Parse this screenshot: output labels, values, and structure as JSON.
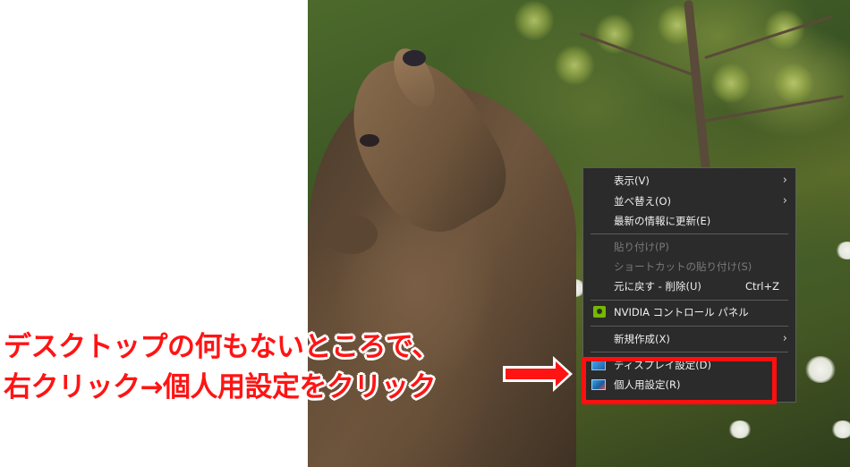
{
  "context_menu": {
    "items": [
      {
        "label": "表示(V)",
        "has_submenu": true,
        "enabled": true
      },
      {
        "label": "並べ替え(O)",
        "has_submenu": true,
        "enabled": true
      },
      {
        "label": "最新の情報に更新(E)",
        "enabled": true
      },
      {
        "label": "貼り付け(P)",
        "enabled": false
      },
      {
        "label": "ショートカットの貼り付け(S)",
        "enabled": false
      },
      {
        "label": "元に戻す - 削除(U)",
        "shortcut": "Ctrl+Z",
        "enabled": true
      },
      {
        "label": "NVIDIA コントロール パネル",
        "icon": "nvidia-icon",
        "enabled": true
      },
      {
        "label": "新規作成(X)",
        "has_submenu": true,
        "enabled": true
      },
      {
        "label": "ディスプレイ設定(D)",
        "icon": "display-settings-icon",
        "enabled": true
      },
      {
        "label": "個人用設定(R)",
        "icon": "personalize-icon",
        "enabled": true
      }
    ],
    "submenu_arrow": "›"
  },
  "annotation": {
    "line1": "デスクトップの何もないところで、",
    "line2": "右クリック→個人用設定をクリック",
    "color": "#ff1414"
  },
  "wallpaper": {
    "subject": "brown bear cub"
  }
}
